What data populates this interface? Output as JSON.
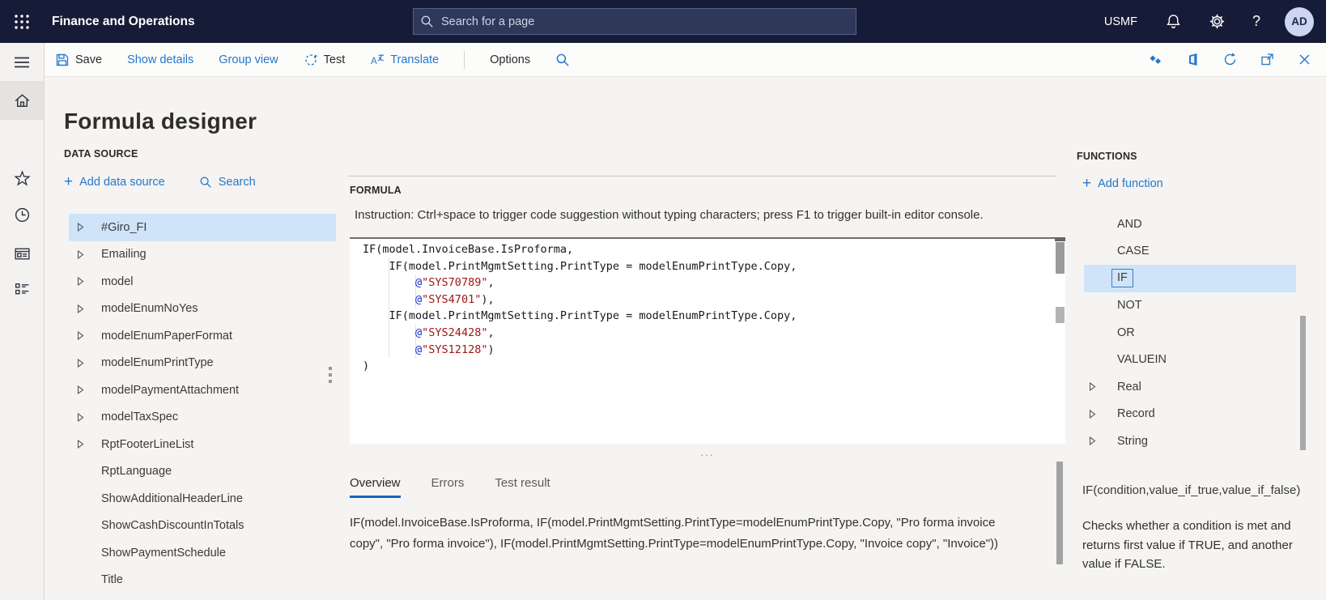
{
  "topbar": {
    "app_title": "Finance and Operations",
    "search_placeholder": "Search for a page",
    "company": "USMF",
    "help_label": "?",
    "avatar_initials": "AD"
  },
  "actionbar": {
    "save_label": "Save",
    "show_details_label": "Show details",
    "group_view_label": "Group view",
    "test_label": "Test",
    "translate_label": "Translate",
    "options_label": "Options"
  },
  "page": {
    "title": "Formula designer"
  },
  "data_source": {
    "heading": "DATA SOURCE",
    "add_label": "Add data source",
    "search_label": "Search",
    "items": [
      {
        "label": "#Giro_FI",
        "expandable": true,
        "selected": true
      },
      {
        "label": "Emailing",
        "expandable": true
      },
      {
        "label": "model",
        "expandable": true
      },
      {
        "label": "modelEnumNoYes",
        "expandable": true
      },
      {
        "label": "modelEnumPaperFormat",
        "expandable": true
      },
      {
        "label": "modelEnumPrintType",
        "expandable": true
      },
      {
        "label": "modelPaymentAttachment",
        "expandable": true
      },
      {
        "label": "modelTaxSpec",
        "expandable": true
      },
      {
        "label": "RptFooterLineList",
        "expandable": true
      },
      {
        "label": "RptLanguage",
        "expandable": false
      },
      {
        "label": "ShowAdditionalHeaderLine",
        "expandable": false
      },
      {
        "label": "ShowCashDiscountInTotals",
        "expandable": false
      },
      {
        "label": "ShowPaymentSchedule",
        "expandable": false
      },
      {
        "label": "Title",
        "expandable": false
      }
    ]
  },
  "formula": {
    "heading": "FORMULA",
    "instruction": "Instruction: Ctrl+space to trigger code suggestion without typing characters; press F1 to trigger built-in editor console.",
    "splitter_dots": "...",
    "code_lines": [
      [
        {
          "t": "IF(model.InvoiceBase.IsProforma,",
          "c": "p"
        }
      ],
      [
        {
          "t": "    IF(model.PrintMgmtSetting.PrintType = modelEnumPrintType.Copy,",
          "c": "p"
        }
      ],
      [
        {
          "t": "        ",
          "c": "p"
        },
        {
          "t": "@",
          "c": "a"
        },
        {
          "t": "\"SYS70789\"",
          "c": "s"
        },
        {
          "t": ",",
          "c": "p"
        }
      ],
      [
        {
          "t": "        ",
          "c": "p"
        },
        {
          "t": "@",
          "c": "a"
        },
        {
          "t": "\"SYS4701\"",
          "c": "s"
        },
        {
          "t": "),",
          "c": "p"
        }
      ],
      [
        {
          "t": "    IF(model.PrintMgmtSetting.PrintType = modelEnumPrintType.Copy,",
          "c": "p"
        }
      ],
      [
        {
          "t": "        ",
          "c": "p"
        },
        {
          "t": "@",
          "c": "a"
        },
        {
          "t": "\"SYS24428\"",
          "c": "s"
        },
        {
          "t": ",",
          "c": "p"
        }
      ],
      [
        {
          "t": "        ",
          "c": "p"
        },
        {
          "t": "@",
          "c": "a"
        },
        {
          "t": "\"SYS12128\"",
          "c": "s"
        },
        {
          "t": ")",
          "c": "p"
        }
      ],
      [
        {
          "t": ")",
          "c": "p"
        }
      ]
    ],
    "tabs": [
      {
        "label": "Overview",
        "active": true
      },
      {
        "label": "Errors",
        "active": false
      },
      {
        "label": "Test result",
        "active": false
      }
    ],
    "overview_text": "IF(model.InvoiceBase.IsProforma, IF(model.PrintMgmtSetting.PrintType=modelEnumPrintType.Copy, \"Pro forma invoice copy\", \"Pro forma invoice\"), IF(model.PrintMgmtSetting.PrintType=modelEnumPrintType.Copy, \"Invoice copy\", \"Invoice\"))"
  },
  "functions_panel": {
    "heading": "FUNCTIONS",
    "add_label": "Add function",
    "items": [
      {
        "label": "AND",
        "expandable": false,
        "selected": false
      },
      {
        "label": "CASE",
        "expandable": false,
        "selected": false
      },
      {
        "label": "IF",
        "expandable": false,
        "selected": true
      },
      {
        "label": "NOT",
        "expandable": false,
        "selected": false
      },
      {
        "label": "OR",
        "expandable": false,
        "selected": false
      },
      {
        "label": "VALUEIN",
        "expandable": false,
        "selected": false
      },
      {
        "label": "Real",
        "expandable": true,
        "selected": false
      },
      {
        "label": "Record",
        "expandable": true,
        "selected": false
      },
      {
        "label": "String",
        "expandable": true,
        "selected": false
      }
    ],
    "signature": "IF(condition,value_if_true,value_if_false)",
    "description": "Checks whether a condition is met and returns first value if TRUE, and another value if FALSE."
  },
  "colors": {
    "topbar_background": "#161c38",
    "accent_blue": "#2676c9",
    "selection_blue": "#cfe4f8",
    "tab_underline": "#1a66b8",
    "code_string_red": "#a31515",
    "code_at_blue": "#1225cc",
    "avatar_background": "#ccd6f1"
  }
}
